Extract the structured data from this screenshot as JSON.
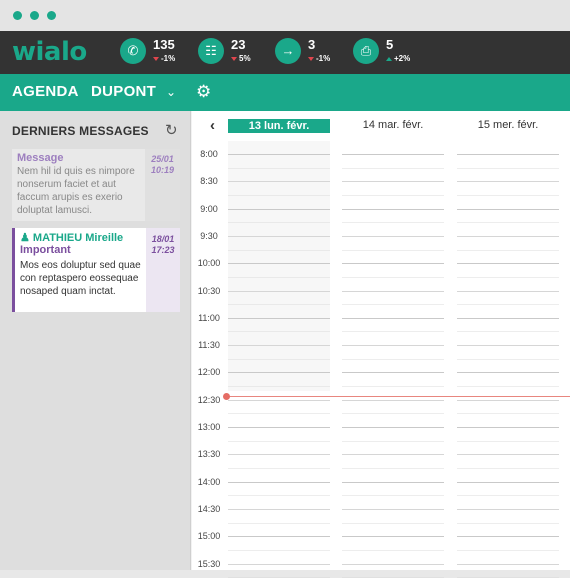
{
  "header": {
    "logo": "wialo",
    "stats": [
      {
        "icon": "phone-icon",
        "value": "135",
        "delta": "-1%",
        "trend": "down"
      },
      {
        "icon": "chat-icon",
        "value": "23",
        "delta": "5%",
        "trend": "down"
      },
      {
        "icon": "transfer-icon",
        "value": "3",
        "delta": "-1%",
        "trend": "down"
      },
      {
        "icon": "fax-icon",
        "value": "5",
        "delta": "+2%",
        "trend": "up"
      }
    ]
  },
  "agenda": {
    "title": "AGENDA",
    "name": "DUPONT"
  },
  "sidebar": {
    "title": "DERNIERS MESSAGES",
    "messages": [
      {
        "title": "Message",
        "text": "Nem hil id quis es nimpore nonserum faciet et aut faccum arupis es exerio doluptat lamusci.",
        "date": "25/01",
        "time": "10:19"
      },
      {
        "sender": "MATHIEU Mireille",
        "tag": "Important",
        "text": "Mos eos doluptur sed quae con reptaspero eossequae nosaped quam inctat.",
        "date": "18/01",
        "time": "17:23"
      }
    ]
  },
  "calendar": {
    "days": [
      {
        "label": "13 lun. févr.",
        "active": true
      },
      {
        "label": "14 mar. févr.",
        "active": false
      },
      {
        "label": "15 mer. févr.",
        "active": false
      }
    ],
    "times": [
      "8:00",
      "8:30",
      "9:00",
      "9:30",
      "10:00",
      "10:30",
      "11:00",
      "11:30",
      "12:00",
      "12:30",
      "13:00",
      "13:30",
      "14:00",
      "14:30",
      "15:00",
      "15:30"
    ],
    "now_time": "12:30"
  },
  "colors": {
    "accent": "#1aa88a",
    "topbar": "#333333",
    "purple": "#7b4f9e",
    "now_line": "#e8867f"
  }
}
